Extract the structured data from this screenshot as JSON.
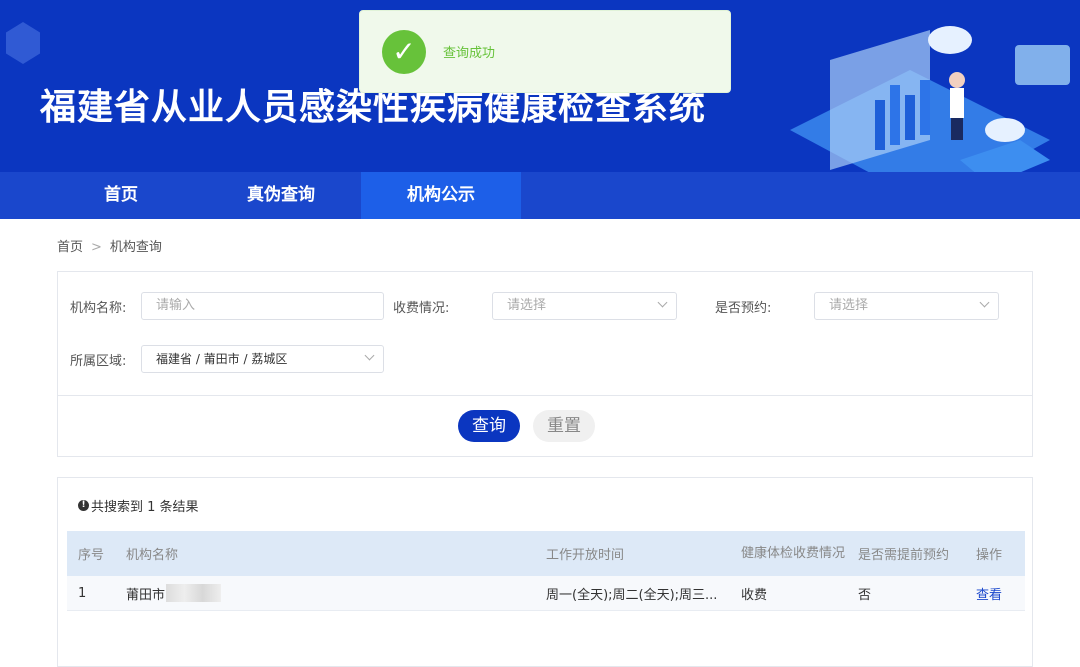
{
  "header": {
    "title": "福建省从业人员感染性疾病健康检查系统"
  },
  "nav": [
    {
      "label": "首页"
    },
    {
      "label": "真伪查询"
    },
    {
      "label": "机构公示"
    }
  ],
  "toast": {
    "message": "查询成功",
    "icon": "check-icon",
    "color": "#67c23a"
  },
  "breadcrumb": {
    "home": "首页",
    "current": "机构查询"
  },
  "filter": {
    "name_label": "机构名称:",
    "name_placeholder": "请输入",
    "fee_label": "收费情况:",
    "fee_placeholder": "请选择",
    "appt_label": "是否预约:",
    "appt_placeholder": "请选择",
    "region_label": "所属区域:",
    "region_value": "福建省 / 莆田市 / 荔城区",
    "query_label": "查询",
    "reset_label": "重置"
  },
  "results": {
    "count_prefix": "共搜索到 1 条结果",
    "columns": [
      "序号",
      "机构名称",
      "工作开放时间",
      "健康体检收费情况",
      "是否需提前预约",
      "操作"
    ],
    "rows": [
      {
        "index": "1",
        "name": "莆田市",
        "hours": "周一(全天);周二(全天);周三...",
        "fee": "收费",
        "appointment": "否",
        "action": "查看"
      }
    ]
  },
  "colors": {
    "header": "#0b36c0",
    "nav": "#1a47cc",
    "nav_active": "#1d5fe8"
  }
}
